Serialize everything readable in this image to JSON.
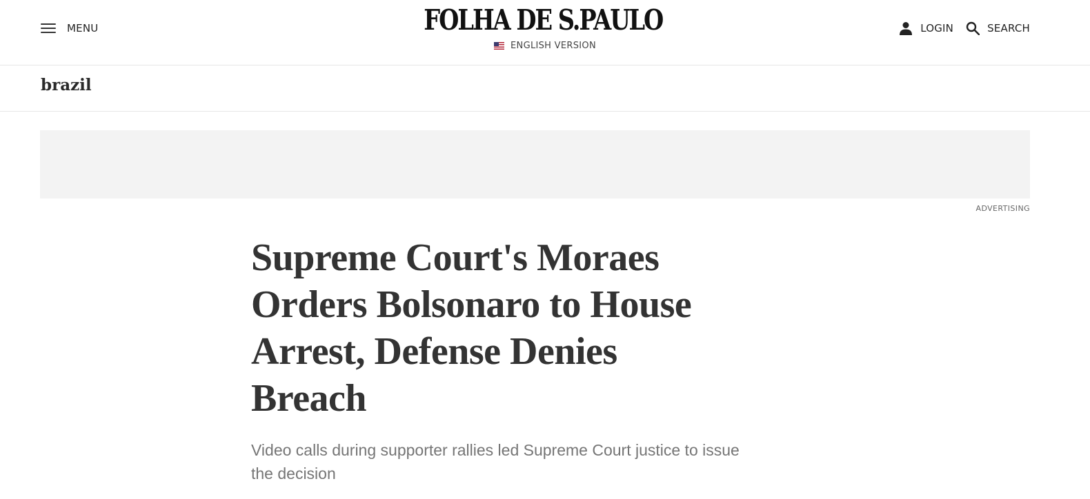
{
  "header": {
    "menu_label": "MENU",
    "logo_text": "FOLHA DE S.PAULO",
    "edition_label": "ENGLISH VERSION",
    "login_label": "LOGIN",
    "search_label": "SEARCH",
    "icons": {
      "menu": "hamburger-menu-icon",
      "flag": "us-flag-icon",
      "login": "user-icon",
      "search": "search-icon"
    }
  },
  "section": {
    "name": "brazil"
  },
  "ad": {
    "label": "ADVERTISING",
    "background": "#f3f3f3"
  },
  "article": {
    "headline": "Supreme Court's Moraes Orders Bolsonaro to House Arrest, Defense Denies Breach",
    "standfirst": "Video calls during supporter rallies led Supreme Court justice to issue the decision"
  },
  "colors": {
    "headline": "#333333",
    "standfirst": "#757575",
    "divider": "#e6e6e6"
  }
}
